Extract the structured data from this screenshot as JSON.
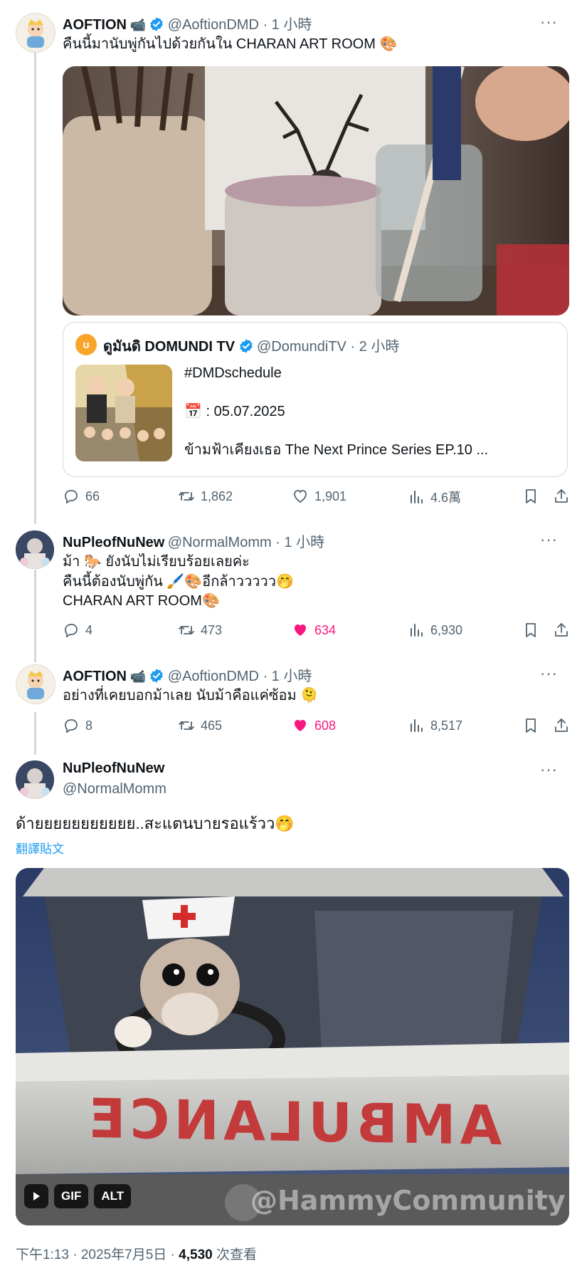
{
  "tweet1": {
    "name": "AOFTION",
    "camera_emoji": "📹",
    "handle": "@AoftionDMD · 1 小時",
    "text": "คืนนี้มานับพู่กันไปด้วยกันใน CHARAN ART ROOM 🎨",
    "quote": {
      "name": "ดูมันดิ DOMUNDI TV",
      "handle": "@DomundiTV · 2 小時",
      "line1": "#DMDschedule",
      "line2": ": 05.07.2025",
      "calendar_emoji": "📅",
      "line3": "ข้ามฟ้าเคียงเธอ The Next Prince Series EP.10 ..."
    },
    "actions": {
      "replies": "66",
      "retweets": "1,862",
      "likes": "1,901",
      "views": "4.6萬"
    }
  },
  "tweet2": {
    "name": "NuPleofNuNew",
    "handle": "@NormalMomm · 1 小時",
    "line1": "ม้า 🐎 ยังนับไม่เรียบร้อยเลยค่ะ",
    "line2": "คืนนี้ต้องนับพู่กัน 🖌️🎨อีกล้าววววว🤭",
    "line3": "CHARAN ART ROOM🎨",
    "actions": {
      "replies": "4",
      "retweets": "473",
      "likes": "634",
      "views": "6,930"
    }
  },
  "tweet3": {
    "name": "AOFTION",
    "camera_emoji": "📹",
    "handle": "@AoftionDMD · 1 小時",
    "text": "อย่างที่เคยบอกม้าเลย นับม้าคือแค่ซ้อม 🫠",
    "actions": {
      "replies": "8",
      "retweets": "465",
      "likes": "608",
      "views": "8,517"
    }
  },
  "main": {
    "name": "NuPleofNuNew",
    "handle": "@NormalMomm",
    "text": "ด้ายยยยยยยยยยย..สะแตนบายรอแร้วว🤭",
    "translate": "翻譯貼文",
    "gif": {
      "badge": "GIF",
      "alt": "ALT",
      "hood_text": "AMBULANCE",
      "watermark": "@HammyCommunity"
    },
    "meta_time": "下午1:13 · 2025年7月5日 · ",
    "meta_views": "4,530",
    "meta_views_label": " 次查看"
  },
  "colors": {
    "link": "#1d9bf0",
    "like": "#f91880",
    "muted": "#536471"
  }
}
